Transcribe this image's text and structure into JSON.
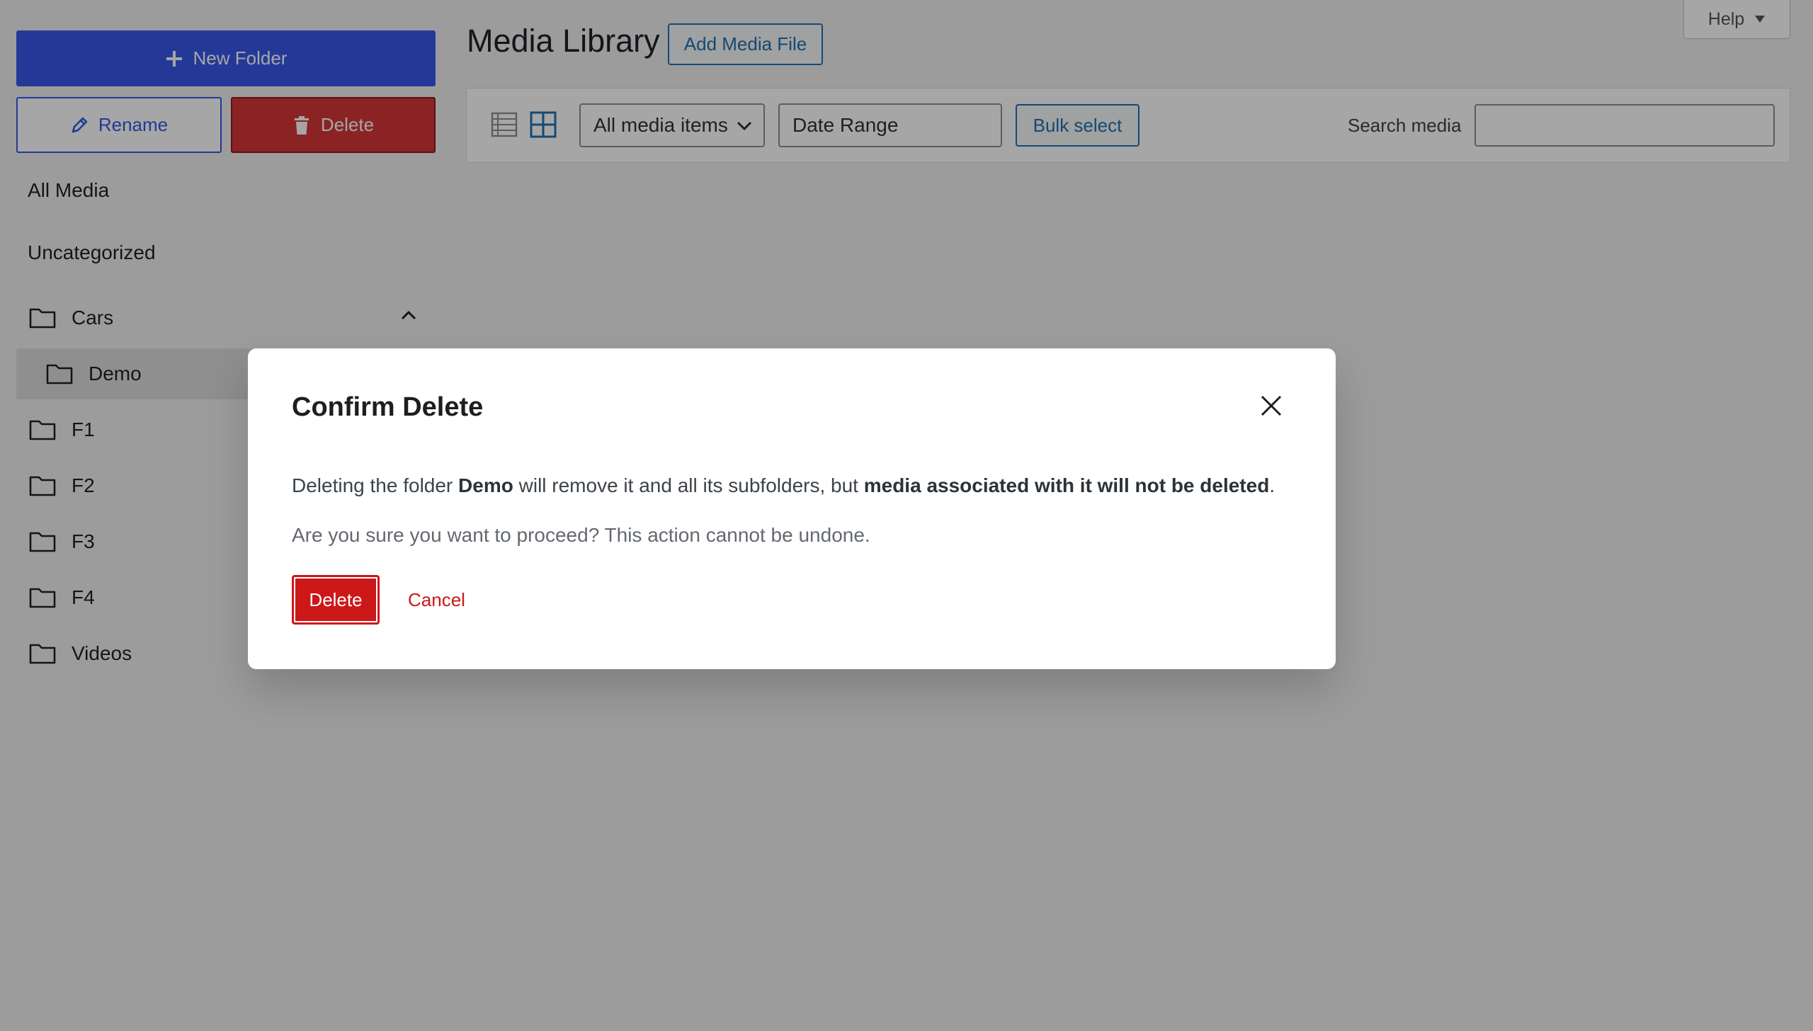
{
  "sidebar": {
    "new_folder_label": "New Folder",
    "rename_label": "Rename",
    "delete_label": "Delete",
    "all_media": "All Media",
    "uncategorized": "Uncategorized",
    "folders": [
      {
        "label": "Cars",
        "expanded": true
      },
      {
        "label": "Demo",
        "selected": true,
        "parent": "Cars"
      },
      {
        "label": "F1"
      },
      {
        "label": "F2"
      },
      {
        "label": "F3"
      },
      {
        "label": "F4"
      },
      {
        "label": "Videos"
      }
    ]
  },
  "header": {
    "title": "Media Library",
    "add_media_label": "Add Media File",
    "help_label": "Help"
  },
  "toolbar": {
    "filter_selected": "All media items",
    "date_range": "Date Range",
    "bulk_select_label": "Bulk select",
    "search_label": "Search media",
    "search_value": ""
  },
  "modal": {
    "title": "Confirm Delete",
    "msg_part1": "Deleting the folder ",
    "folder_name": "Demo",
    "msg_part2": " will remove it and all its subfolders, but ",
    "msg_bold": "media associated with it will not be deleted",
    "msg_end": ".",
    "warning": "Are you sure you want to proceed? This action cannot be undone.",
    "delete_label": "Delete",
    "cancel_label": "Cancel"
  },
  "icons": {
    "plus": "plus-icon",
    "pencil": "pencil-icon",
    "trash": "trash-icon",
    "folder": "folder-icon",
    "chevron_up": "chevron-up-icon",
    "list_view": "list-view-icon",
    "grid_view": "grid-view-icon",
    "close": "close-icon"
  },
  "colors": {
    "primary": "#3858e9",
    "danger": "#d63638",
    "modal_danger": "#cc1818",
    "link": "#2271b1"
  }
}
